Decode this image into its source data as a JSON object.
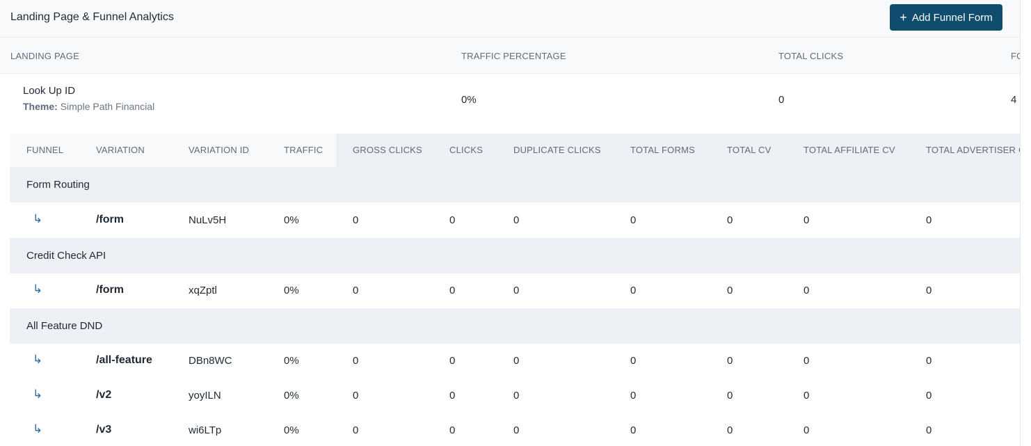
{
  "header": {
    "title": "Landing Page & Funnel Analytics",
    "add_button": {
      "icon": "+",
      "label": "Add Funnel Form"
    }
  },
  "landing_table": {
    "columns": [
      "LANDING PAGE",
      "TRAFFIC PERCENTAGE",
      "TOTAL CLICKS",
      "FO"
    ],
    "row": {
      "name": "Look Up ID",
      "theme_label": "Theme:",
      "theme_value": "Simple Path Financial",
      "traffic_percentage": "0%",
      "total_clicks": "0",
      "fo": "4"
    }
  },
  "funnel_table": {
    "columns": [
      "FUNNEL",
      "VARIATION",
      "VARIATION ID",
      "TRAFFIC",
      "GROSS CLICKS",
      "CLICKS",
      "DUPLICATE CLICKS",
      "TOTAL FORMS",
      "TOTAL CV",
      "TOTAL AFFILIATE CV",
      "TOTAL ADVERTISER C"
    ],
    "arrow_glyph": "↳",
    "groups": [
      {
        "name": "Form Routing",
        "rows": [
          {
            "variation": "/form",
            "variation_id": "NuLv5H",
            "traffic": "0%",
            "gross_clicks": "0",
            "clicks": "0",
            "duplicate_clicks": "0",
            "total_forms": "0",
            "total_cv": "0",
            "total_affiliate_cv": "0",
            "total_advertiser_cv": "0"
          }
        ]
      },
      {
        "name": "Credit Check API",
        "rows": [
          {
            "variation": "/form",
            "variation_id": "xqZptl",
            "traffic": "0%",
            "gross_clicks": "0",
            "clicks": "0",
            "duplicate_clicks": "0",
            "total_forms": "0",
            "total_cv": "0",
            "total_affiliate_cv": "0",
            "total_advertiser_cv": "0"
          }
        ]
      },
      {
        "name": "All Feature DND",
        "rows": [
          {
            "variation": "/all-feature",
            "variation_id": "DBn8WC",
            "traffic": "0%",
            "gross_clicks": "0",
            "clicks": "0",
            "duplicate_clicks": "0",
            "total_forms": "0",
            "total_cv": "0",
            "total_affiliate_cv": "0",
            "total_advertiser_cv": "0"
          },
          {
            "variation": "/v2",
            "variation_id": "yoyILN",
            "traffic": "0%",
            "gross_clicks": "0",
            "clicks": "0",
            "duplicate_clicks": "0",
            "total_forms": "0",
            "total_cv": "0",
            "total_affiliate_cv": "0",
            "total_advertiser_cv": "0"
          },
          {
            "variation": "/v3",
            "variation_id": "wi6LTp",
            "traffic": "0%",
            "gross_clicks": "0",
            "clicks": "0",
            "duplicate_clicks": "0",
            "total_forms": "0",
            "total_cv": "0",
            "total_affiliate_cv": "0",
            "total_advertiser_cv": "0"
          }
        ]
      }
    ]
  }
}
